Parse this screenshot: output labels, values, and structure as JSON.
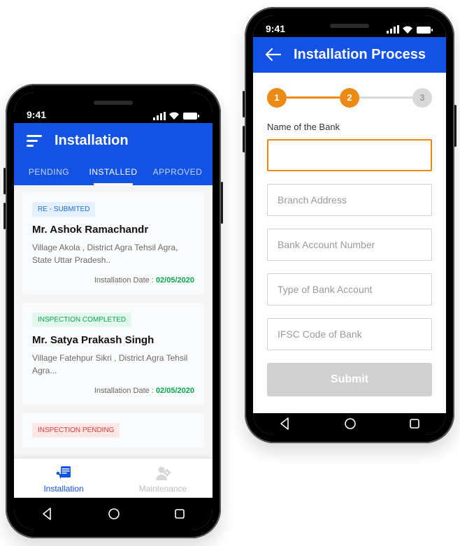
{
  "status_time": "9:41",
  "left": {
    "title": "Installation",
    "tabs": [
      "PENDING",
      "INSTALLED",
      "APPROVED"
    ],
    "active_tab": 1,
    "cards": [
      {
        "status": "RE - SUBMITED",
        "status_kind": "blue",
        "name": "Mr. Ashok  Ramachandr",
        "address": "Village Akola , District Agra Tehsil Agra, State Uttar Pradesh..",
        "date_label": "Installation Date : ",
        "date": "02/05/2020"
      },
      {
        "status": "INSPECTION COMPLETED",
        "status_kind": "green",
        "name": "Mr. Satya Prakash Singh",
        "address": "Village Fatehpur Sikri , District Agra Tehsil Agra...",
        "date_label": "Installation Date : ",
        "date": "02/05/2020"
      },
      {
        "status": "INSPECTION PENDING",
        "status_kind": "red",
        "name": "",
        "address": "",
        "date_label": "",
        "date": ""
      }
    ],
    "bottom": [
      {
        "label": "Installation",
        "active": true
      },
      {
        "label": "Maintenance",
        "active": false
      }
    ]
  },
  "right": {
    "title": "Installation Process",
    "steps": [
      "1",
      "2",
      "3"
    ],
    "active_step": 2,
    "label": "Name of the Bank",
    "fields": [
      {
        "placeholder": "",
        "focus": true
      },
      {
        "placeholder": "Branch Address",
        "focus": false
      },
      {
        "placeholder": "Bank Account Number",
        "focus": false
      },
      {
        "placeholder": "Type of Bank Account",
        "focus": false
      },
      {
        "placeholder": "IFSC Code of Bank",
        "focus": false
      }
    ],
    "submit": "Submit"
  }
}
